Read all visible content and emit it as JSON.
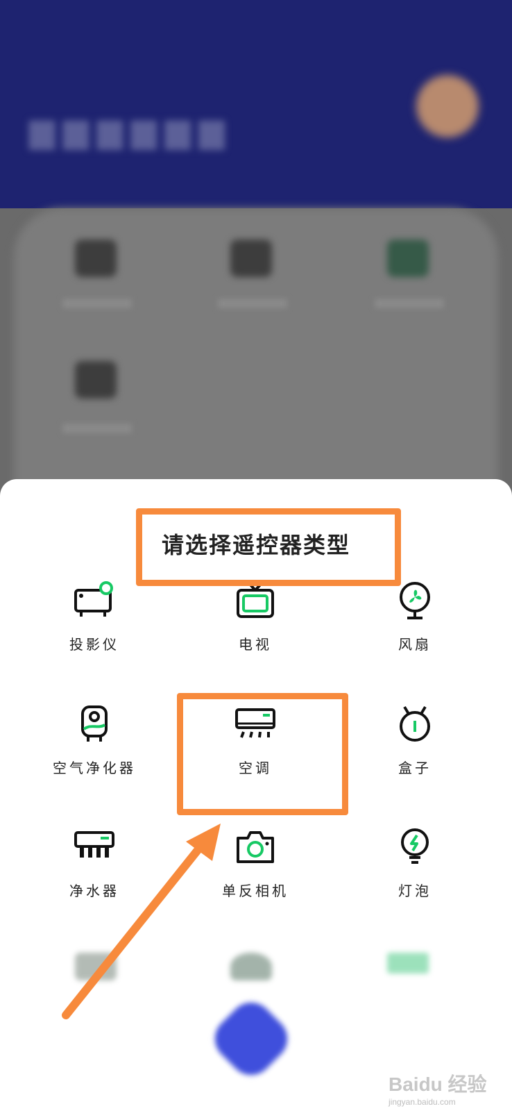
{
  "sheet": {
    "title": "请选择遥控器类型",
    "items": [
      {
        "label": "投影仪",
        "icon": "projector-icon"
      },
      {
        "label": "电视",
        "icon": "tv-icon"
      },
      {
        "label": "风扇",
        "icon": "fan-icon"
      },
      {
        "label": "空气净化器",
        "icon": "air-purifier-icon"
      },
      {
        "label": "空调",
        "icon": "air-conditioner-icon"
      },
      {
        "label": "盒子",
        "icon": "tv-box-icon"
      },
      {
        "label": "净水器",
        "icon": "water-purifier-icon"
      },
      {
        "label": "单反相机",
        "icon": "camera-icon"
      },
      {
        "label": "灯泡",
        "icon": "bulb-icon"
      }
    ]
  },
  "watermark": {
    "brand": "Baidu 经验",
    "url": "jingyan.baidu.com"
  },
  "colors": {
    "accent": "#17c964",
    "header": "#1e2370",
    "highlight": "#f78a3c",
    "fab": "#3f4fdc"
  }
}
